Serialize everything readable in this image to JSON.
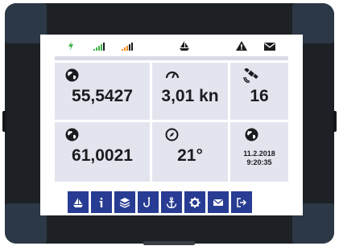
{
  "status_bar": {
    "icons": [
      "power-icon",
      "signal-bars-green-icon",
      "signal-bars-orange-icon",
      "sailboat-icon",
      "warning-icon",
      "mail-icon"
    ],
    "colors": {
      "power": "#3fb24a",
      "signal_green": "#3fb24a",
      "signal_orange": "#f08a1c",
      "dark": "#1b1c20"
    }
  },
  "tiles": {
    "latitude": {
      "icon": "globe-icon",
      "value": "55,5427"
    },
    "speed": {
      "icon": "speedometer-icon",
      "value": "3,01 kn"
    },
    "satellites": {
      "icon": "satellite-icon",
      "value": "16"
    },
    "longitude": {
      "icon": "globe-icon",
      "value": "61,0021"
    },
    "heading": {
      "icon": "compass-icon",
      "value": "21°"
    },
    "datetime": {
      "icon": "globe-icon",
      "date": "11.2.2018",
      "time": "9:20:35"
    }
  },
  "nav": {
    "accent": "#273c92",
    "buttons": [
      "sailboat-icon",
      "info-icon",
      "layers-icon",
      "hook-icon",
      "anchor-icon",
      "settings-icon",
      "mail-icon",
      "logout-icon"
    ]
  }
}
